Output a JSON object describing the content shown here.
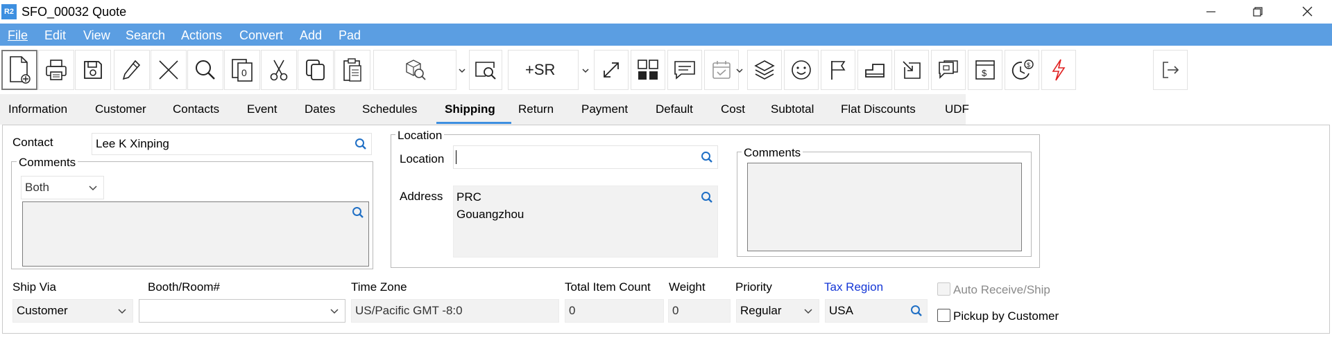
{
  "window": {
    "logo_text": "R2",
    "title": "SFO_00032 Quote",
    "controls": [
      "minimize-icon",
      "restore-icon",
      "close-icon"
    ]
  },
  "menu": {
    "items": [
      "File",
      "Edit",
      "View",
      "Search",
      "Actions",
      "Convert",
      "Add",
      "Pad"
    ]
  },
  "toolbar": {
    "icons": [
      "new-document-icon",
      "print-icon",
      "save-icon",
      "edit-pencil-icon",
      "delete-x-icon",
      "search-icon",
      "copy-icon",
      "cut-icon",
      "duplicate-icon",
      "paste-icon",
      "lookup-icon",
      "preview-search-icon",
      "add-sr-icon",
      "expand-icon",
      "grid-icon",
      "comment-icon",
      "calendar-check-icon",
      "layers-icon",
      "smiley-icon",
      "flag-icon",
      "stamp-icon",
      "import-icon",
      "chat-icon",
      "invoice-icon",
      "clock-dollar-icon",
      "lightning-icon",
      "logout-icon"
    ],
    "sr_label": "+SR"
  },
  "tabs": {
    "items": [
      "Information",
      "Customer",
      "Contacts",
      "Event",
      "Dates",
      "Schedules",
      "Shipping",
      "Return",
      "Payment",
      "Default",
      "Cost",
      "Subtotal",
      "Flat Discounts",
      "UDF"
    ],
    "active": "Shipping"
  },
  "form": {
    "contact": {
      "label": "Contact",
      "value": "Lee K Xinping"
    },
    "comments_left": {
      "title": "Comments",
      "select_value": "Both"
    },
    "location_group": {
      "title": "Location",
      "location_label": "Location",
      "location_value": "",
      "address_label": "Address",
      "address_line1": "PRC",
      "address_line2": "Gouangzhou"
    },
    "comments_right": {
      "title": "Comments"
    },
    "ship_via": {
      "label": "Ship Via",
      "value": "Customer"
    },
    "booth_room": {
      "label": "Booth/Room#",
      "value": ""
    },
    "time_zone": {
      "label": "Time Zone",
      "value": "US/Pacific GMT -8:0"
    },
    "total_item_count": {
      "label": "Total Item Count",
      "value": "0"
    },
    "weight": {
      "label": "Weight",
      "value": "0"
    },
    "priority": {
      "label": "Priority",
      "value": "Regular"
    },
    "tax_region": {
      "label": "Tax Region",
      "value": "USA",
      "link_color": "#1436d6"
    },
    "auto_receive_ship": {
      "label": "Auto Receive/Ship",
      "checked": false,
      "disabled": true
    },
    "pickup_by_customer": {
      "label": "Pickup by Customer",
      "checked": false
    }
  },
  "colors": {
    "menubar": "#5b9ee2",
    "accent": "#3d8fe0",
    "search_icon": "#1f6fc5"
  }
}
